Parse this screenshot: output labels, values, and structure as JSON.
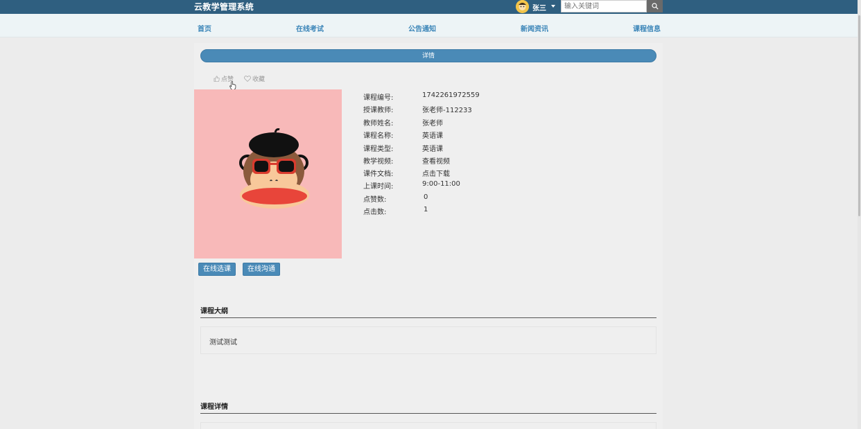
{
  "header": {
    "brand": "云教学管理系统",
    "user_name": "张三",
    "search_placeholder": "输入关键词"
  },
  "nav": [
    "首页",
    "在线考试",
    "公告通知",
    "新闻资讯",
    "课程信息"
  ],
  "detail": {
    "banner_label": "详情",
    "like_label": "点赞",
    "favorite_label": "收藏",
    "fields": [
      {
        "label": "课程编号:",
        "value": "1742261972559"
      },
      {
        "label": "授课教师:",
        "value": "张老师-112233"
      },
      {
        "label": "教师姓名:",
        "value": "张老师"
      },
      {
        "label": "课程名称:",
        "value": "英语课"
      },
      {
        "label": "课程类型:",
        "value": "英语课"
      },
      {
        "label": "教学视频:",
        "value": "查看视频"
      },
      {
        "label": "课件文档:",
        "value": "点击下载"
      },
      {
        "label": "上课时间:",
        "value": "9:00-11:00"
      },
      {
        "label": "点赞数:",
        "value": "0"
      },
      {
        "label": "点击数:",
        "value": "1"
      }
    ],
    "enroll_button": "在线选课",
    "chat_button": "在线沟通"
  },
  "syllabus": {
    "title": "课程大纲",
    "content": "测试测试"
  },
  "course_details": {
    "title": "课程详情"
  },
  "colors": {
    "topbar": "#2f5f80",
    "accent": "#4a8ab7",
    "nav_text": "#3b85b8",
    "cover_bg": "#f8b9b9"
  }
}
